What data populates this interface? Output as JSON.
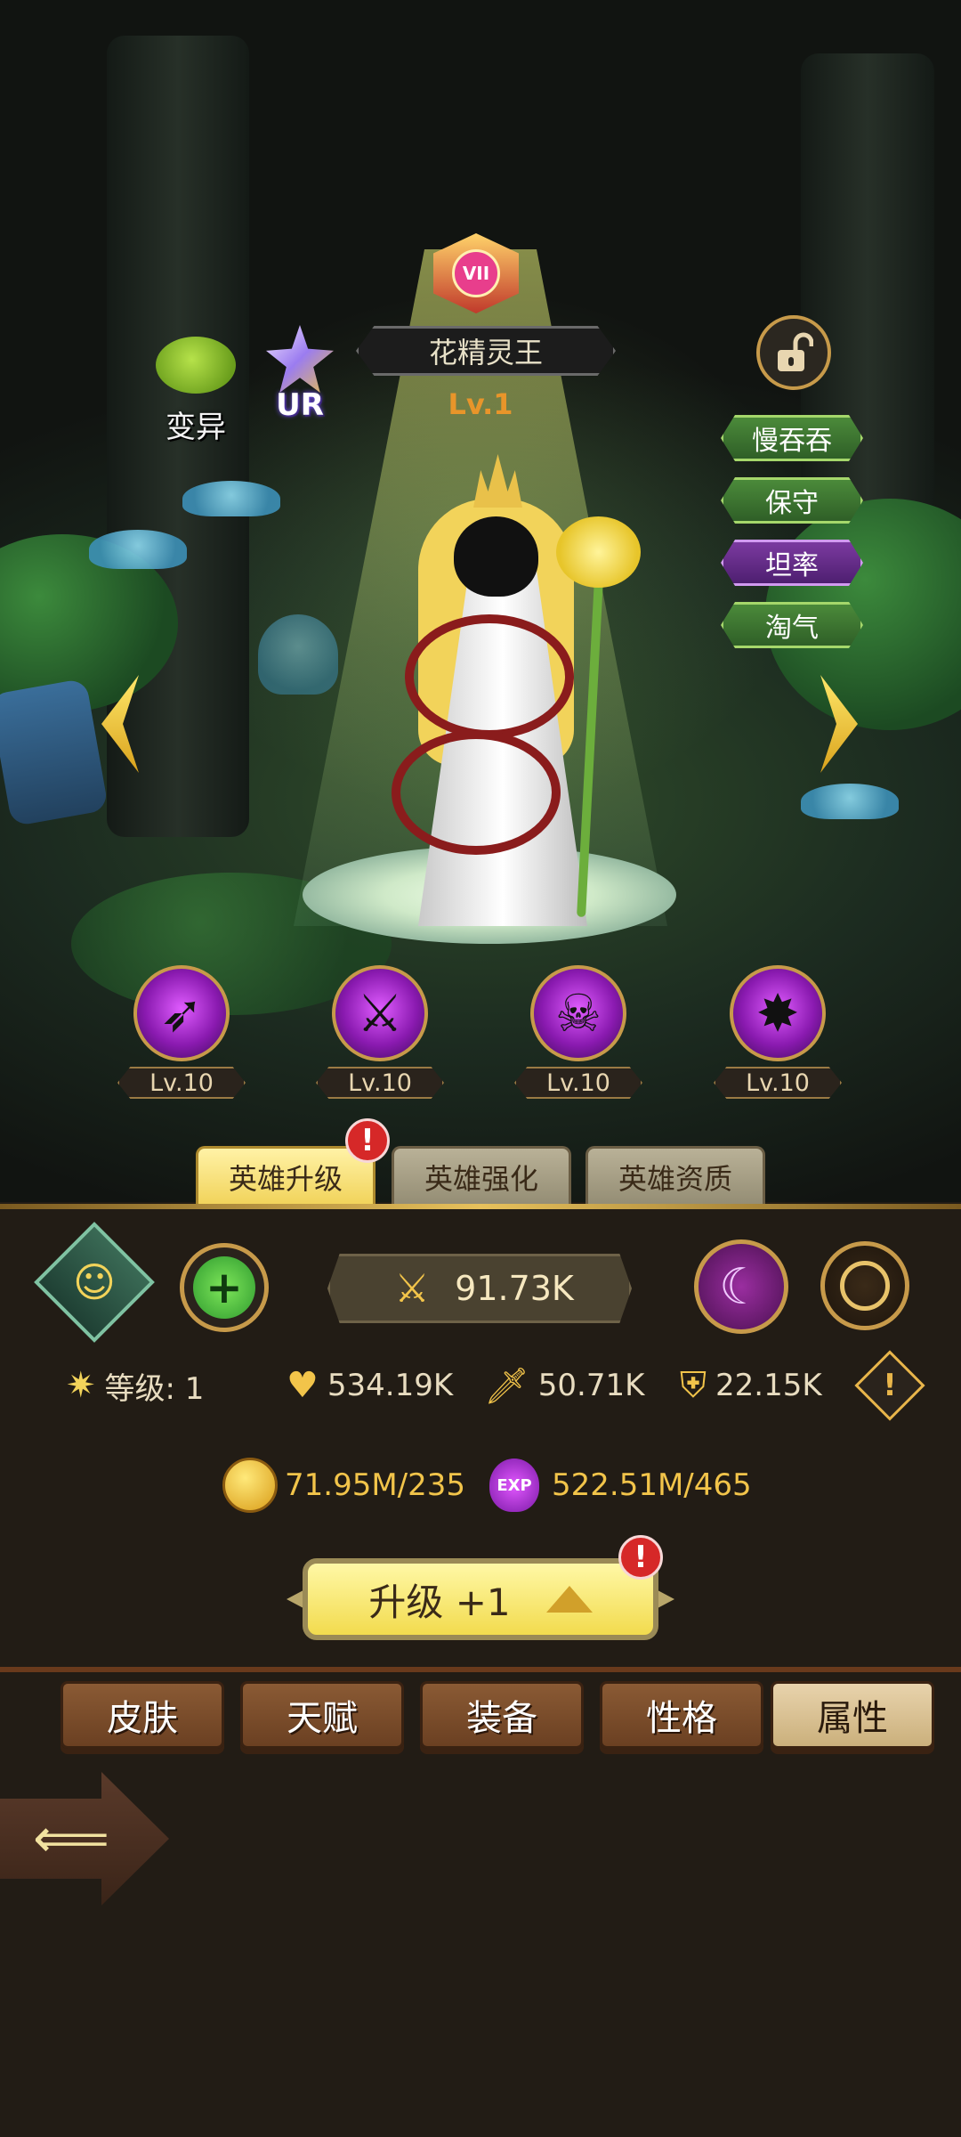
{
  "hero": {
    "rank_badge": "VII",
    "name": "花精灵王",
    "level": "Lv.1",
    "mutation_label": "变异",
    "rarity": "UR",
    "traits": [
      "慢吞吞",
      "保守",
      "坦率",
      "淘气"
    ],
    "skills": [
      {
        "icon": "dash-skill-icon",
        "level": "Lv.10"
      },
      {
        "icon": "slash-skill-icon",
        "level": "Lv.10"
      },
      {
        "icon": "skull-skill-icon",
        "level": "Lv.10"
      },
      {
        "icon": "shatter-skill-icon",
        "level": "Lv.10"
      }
    ]
  },
  "tabs": [
    "英雄升级",
    "英雄强化",
    "英雄资质"
  ],
  "panel": {
    "power": "91.73K",
    "level_label": "等级: 1",
    "hp": "534.19K",
    "attack": "50.71K",
    "defense": "22.15K",
    "gold_cost": "71.95M/235",
    "exp_cost": "522.51M/465",
    "exp_icon_text": "EXP",
    "upgrade_label": "升级 +1"
  },
  "menu": [
    "皮肤",
    "天赋",
    "装备",
    "性格",
    "属性"
  ],
  "colors": {
    "accent_gold": "#f2c44a",
    "tab_active": "#f1d35a",
    "skill_purple": "#8a1ab0",
    "alert_red": "#d62828"
  }
}
